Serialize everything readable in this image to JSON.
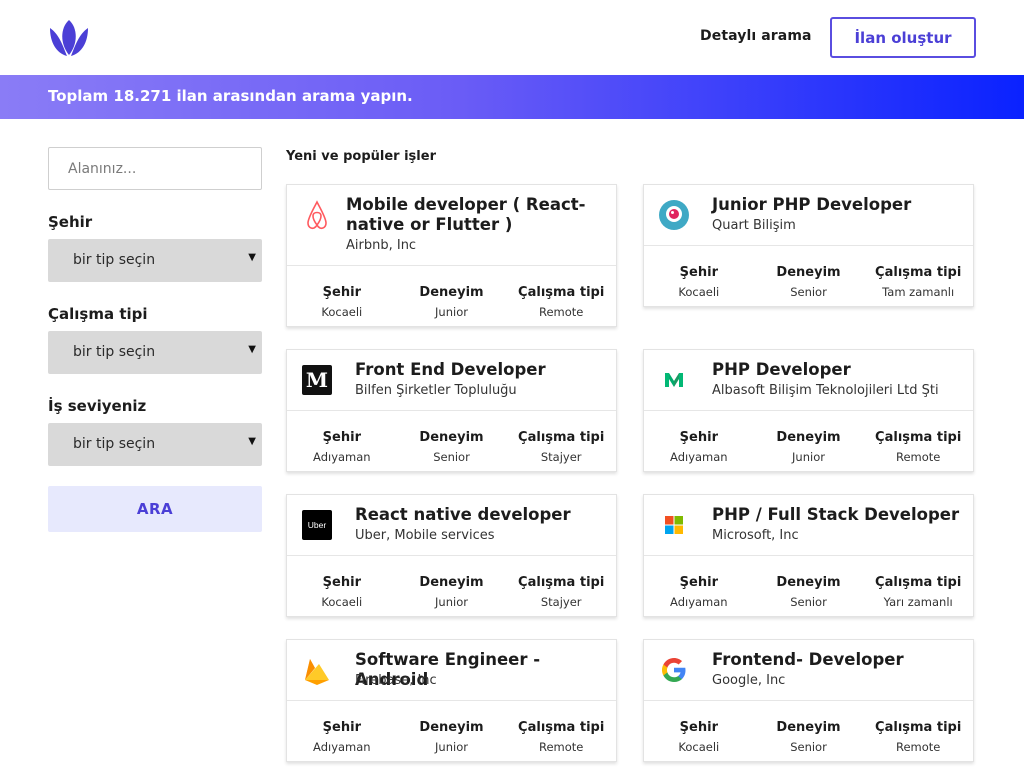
{
  "header": {
    "nav_link": "Detaylı arama",
    "create_button": "İlan oluştur"
  },
  "banner": {
    "text": "Toplam 18.271 ilan arasından arama yapın."
  },
  "sidebar": {
    "search_placeholder": "Alanınız...",
    "filters": [
      {
        "label": "Şehir",
        "value": "bir tip seçin"
      },
      {
        "label": "Çalışma tipi",
        "value": "bir tip seçin"
      },
      {
        "label": "İş seviyeniz",
        "value": "bir tip seçin"
      }
    ],
    "search_button": "ARA"
  },
  "main": {
    "section_title": "Yeni ve popüler işler",
    "meta_labels": {
      "city": "Şehir",
      "experience": "Deneyim",
      "work_type": "Çalışma tipi"
    },
    "jobs": [
      {
        "title": "Mobile developer ( React-native or Flutter )",
        "company": "Airbnb, Inc",
        "city": "Kocaeli",
        "experience": "Junior",
        "work_type": "Remote",
        "icon": "airbnb-icon"
      },
      {
        "title": "Junior PHP Developer",
        "company": "Quart Bilişim",
        "city": "Kocaeli",
        "experience": "Senior",
        "work_type": "Tam zamanlı",
        "icon": "periscope-icon"
      },
      {
        "title": "Front End Developer",
        "company": "Bilfen Şirketler Topluluğu",
        "city": "Adıyaman",
        "experience": "Senior",
        "work_type": "Stajyer",
        "icon": "medium-icon"
      },
      {
        "title": "PHP Developer",
        "company": "Albasoft Bilişim Teknolojileri Ltd Şti",
        "city": "Adıyaman",
        "experience": "Junior",
        "work_type": "Remote",
        "icon": "medium-color-icon"
      },
      {
        "title": "React native developer",
        "company": "Uber, Mobile services",
        "city": "Kocaeli",
        "experience": "Junior",
        "work_type": "Stajyer",
        "icon": "uber-icon",
        "icon_text": "Uber"
      },
      {
        "title": "PHP / Full Stack Developer",
        "company": "Microsoft, Inc",
        "city": "Adıyaman",
        "experience": "Senior",
        "work_type": "Yarı zamanlı",
        "icon": "microsoft-icon"
      },
      {
        "title": "Software Engineer - Android",
        "company": "Firebase, Inc",
        "city": "Adıyaman",
        "experience": "Junior",
        "work_type": "Remote",
        "icon": "firebase-icon"
      },
      {
        "title": "Frontend- Developer",
        "company": "Google, Inc",
        "city": "Kocaeli",
        "experience": "Senior",
        "work_type": "Remote",
        "icon": "google-icon"
      }
    ]
  },
  "colors": {
    "accent": "#4b3fd6",
    "banner_start": "#8a7cf6",
    "banner_end": "#0a22ff"
  }
}
